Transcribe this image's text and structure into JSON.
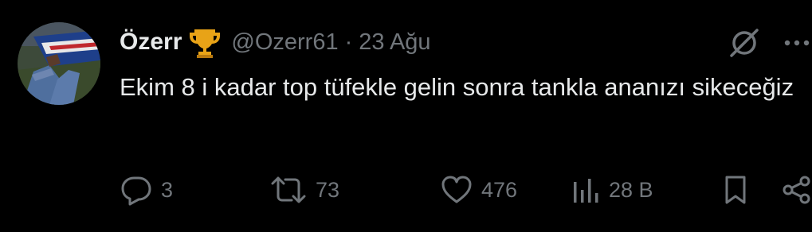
{
  "tweet": {
    "display_name": "Özerr",
    "badge_icon": "trophy-icon",
    "handle": "@Ozerr61",
    "separator": "·",
    "date": "23 Ağu",
    "text": "Ekim 8 i kadar top tüfekle gelin sonra tankla ananızı sikeceğiz"
  },
  "actions": {
    "reply_count": "3",
    "retweet_count": "73",
    "like_count": "476",
    "views_count": "28 B"
  },
  "icons": {
    "grok": "grok-icon",
    "more": "more-icon",
    "reply": "reply-icon",
    "retweet": "retweet-icon",
    "like": "heart-icon",
    "views": "views-icon",
    "bookmark": "bookmark-icon",
    "share": "share-icon"
  },
  "colors": {
    "background": "#000000",
    "primary_text": "#e7e9ea",
    "secondary_text": "#71767b",
    "trophy": "#e8a317"
  }
}
